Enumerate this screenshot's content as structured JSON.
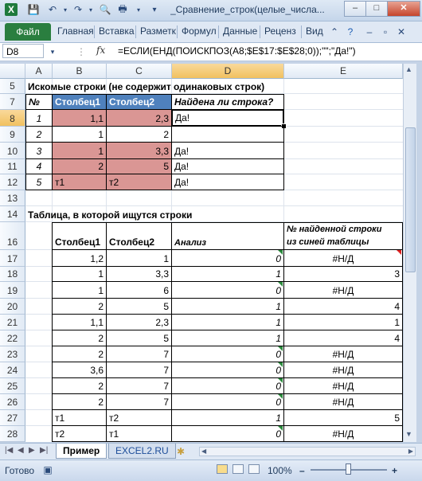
{
  "window": {
    "title": "_Сравнение_строк(целые_числа...",
    "minimize": "–",
    "maximize": "□",
    "close": "✕",
    "doc_min": "–",
    "doc_restore": "▫",
    "doc_close": "✕",
    "help": "?"
  },
  "ribbon": {
    "file_tab": "Файл",
    "tabs": [
      "Главная",
      "Вставка",
      "Разметк",
      "Формул",
      "Данные",
      "Реценз",
      "Вид"
    ]
  },
  "formula_bar": {
    "name_box": "D8",
    "fx": "fx",
    "formula": "=ЕСЛИ(ЕНД(ПОИСКПОЗ(A8;$E$17:$E$28;0));\"\";\"Да!\")"
  },
  "columns": [
    "A",
    "B",
    "C",
    "D",
    "E"
  ],
  "rows": [
    "5",
    "7",
    "8",
    "9",
    "10",
    "11",
    "12",
    "13",
    "14",
    "16",
    "17",
    "18",
    "19",
    "20",
    "21",
    "22",
    "23",
    "24",
    "25",
    "26",
    "27",
    "28"
  ],
  "sheet": {
    "title1": "Искомые строки (не содержит одинаковых строк)",
    "h_num": "№",
    "h_col1": "Столбец1",
    "h_col2": "Столбец2",
    "h_found": "Найдена ли строка?",
    "top_rows": [
      [
        "1",
        "1,1",
        "2,3",
        "Да!"
      ],
      [
        "2",
        "1",
        "2",
        ""
      ],
      [
        "3",
        "1",
        "3,3",
        "Да!"
      ],
      [
        "4",
        "2",
        "5",
        "Да!"
      ],
      [
        "5",
        "т1",
        "т2",
        "Да!"
      ]
    ],
    "title2": "Таблица, в которой ищутся строки",
    "h2_col1": "Столбец1",
    "h2_col2": "Столбец2",
    "h2_analysis": "Анализ",
    "h2_found_line1": "№ найденной строки",
    "h2_found_line2": "из синей таблицы",
    "bottom_rows": [
      [
        "1,2",
        "1",
        "0",
        "#Н/Д"
      ],
      [
        "1",
        "3,3",
        "1",
        "3"
      ],
      [
        "1",
        "6",
        "0",
        "#Н/Д"
      ],
      [
        "2",
        "5",
        "1",
        "4"
      ],
      [
        "1,1",
        "2,3",
        "1",
        "1"
      ],
      [
        "2",
        "5",
        "1",
        "4"
      ],
      [
        "2",
        "7",
        "0",
        "#Н/Д"
      ],
      [
        "3,6",
        "7",
        "0",
        "#Н/Д"
      ],
      [
        "2",
        "7",
        "0",
        "#Н/Д"
      ],
      [
        "2",
        "7",
        "0",
        "#Н/Д"
      ],
      [
        "т1",
        "т2",
        "1",
        "5"
      ],
      [
        "т2",
        "т1",
        "0",
        "#Н/Д"
      ]
    ]
  },
  "sheet_tabs": [
    "Пример",
    "EXCEL2.RU"
  ],
  "status": {
    "ready": "Готово",
    "zoom": "100%",
    "zoom_minus": "–",
    "zoom_plus": "+"
  },
  "colors": {
    "header_blue": "#4f81bd",
    "row_pink": "#da9694",
    "file_tab_green": "#2a7e3f"
  }
}
